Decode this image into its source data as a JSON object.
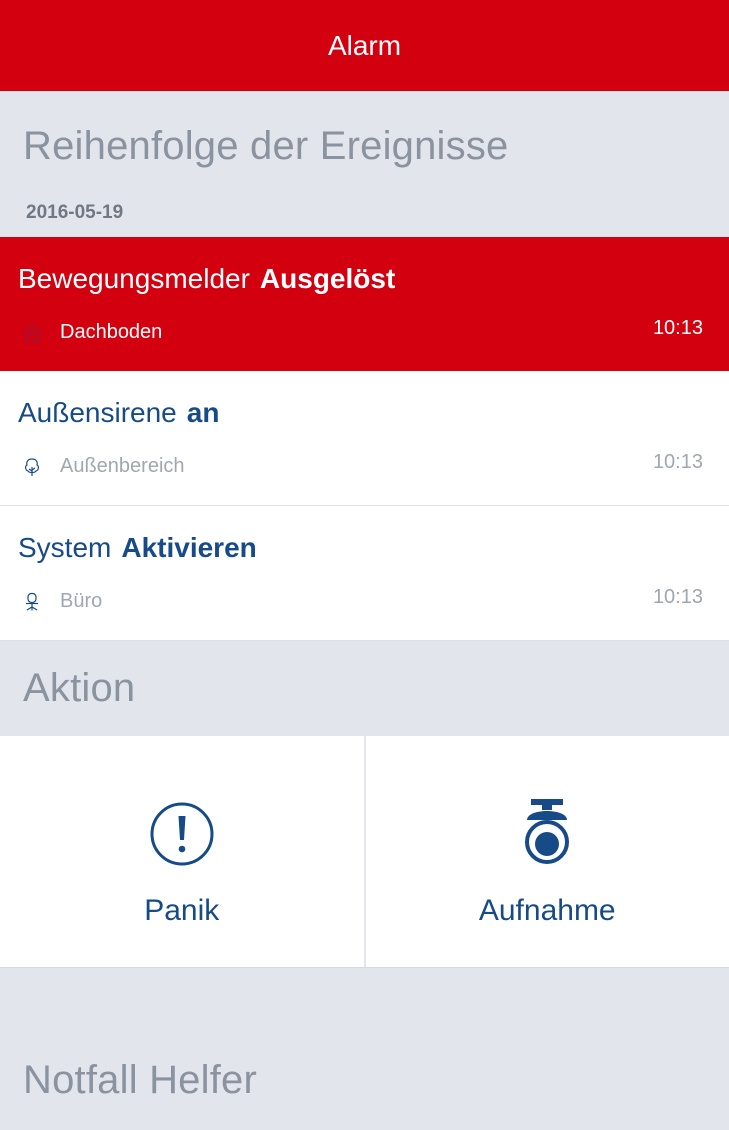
{
  "header": {
    "title": "Alarm"
  },
  "events_section": {
    "title": "Reihenfolge der Ereignisse",
    "date": "2016-05-19"
  },
  "events": [
    {
      "device": "Bewegungsmelder",
      "state": "Ausgelöst",
      "location": "Dachboden",
      "location_icon": "house-icon",
      "time": "10:13",
      "highlight": true
    },
    {
      "device": "Außensirene",
      "state": "an",
      "location": "Außenbereich",
      "location_icon": "tree-icon",
      "time": "10:13",
      "highlight": false
    },
    {
      "device": "System",
      "state": "Aktivieren",
      "location": "Büro",
      "location_icon": "office-chair-icon",
      "time": "10:13",
      "highlight": false
    }
  ],
  "action_section": {
    "title": "Aktion"
  },
  "actions": [
    {
      "label": "Panik",
      "icon": "exclamation-circle-icon"
    },
    {
      "label": "Aufnahme",
      "icon": "security-camera-icon"
    }
  ],
  "helper_section": {
    "title": "Notfall Helfer"
  },
  "colors": {
    "accent_red": "#d3000f",
    "brand_blue": "#164b88",
    "background": "#e2e6ec"
  }
}
